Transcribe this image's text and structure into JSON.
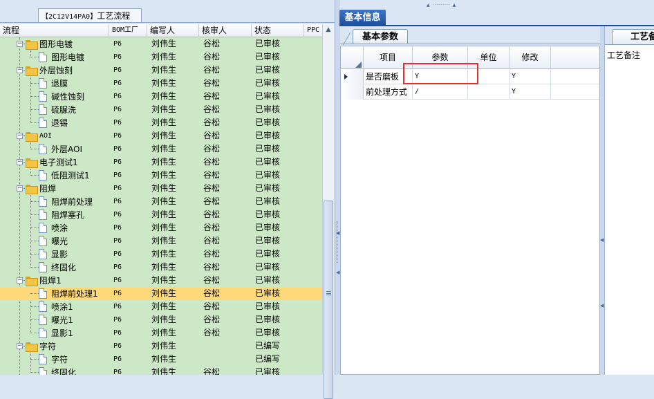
{
  "left_tab": {
    "code": "【2C12V14PA0】",
    "label": "工艺流程"
  },
  "tree_columns": [
    "流程",
    "BOM工厂",
    "编写人",
    "核审人",
    "状态",
    "PPC"
  ],
  "tree_rows": [
    {
      "level": 1,
      "type": "folder",
      "name": "图形电镀",
      "bom": "P6",
      "writer": "刘伟生",
      "reviewer": "谷松",
      "status": "已审核"
    },
    {
      "level": 2,
      "type": "doc",
      "name": "图形电镀",
      "bom": "P6",
      "writer": "刘伟生",
      "reviewer": "谷松",
      "status": "已审核"
    },
    {
      "level": 1,
      "type": "folder",
      "name": "外层蚀刻",
      "bom": "P6",
      "writer": "刘伟生",
      "reviewer": "谷松",
      "status": "已审核"
    },
    {
      "level": 2,
      "type": "doc",
      "name": "退膜",
      "bom": "P6",
      "writer": "刘伟生",
      "reviewer": "谷松",
      "status": "已审核"
    },
    {
      "level": 2,
      "type": "doc",
      "name": "碱性蚀刻",
      "bom": "P6",
      "writer": "刘伟生",
      "reviewer": "谷松",
      "status": "已审核"
    },
    {
      "level": 2,
      "type": "doc",
      "name": "硫脲洗",
      "bom": "P6",
      "writer": "刘伟生",
      "reviewer": "谷松",
      "status": "已审核"
    },
    {
      "level": 2,
      "type": "doc",
      "name": "退锡",
      "bom": "P6",
      "writer": "刘伟生",
      "reviewer": "谷松",
      "status": "已审核"
    },
    {
      "level": 1,
      "type": "folder",
      "name": "AOI",
      "bom": "P6",
      "writer": "刘伟生",
      "reviewer": "谷松",
      "status": "已审核"
    },
    {
      "level": 2,
      "type": "doc",
      "name": "外层AOI",
      "bom": "P6",
      "writer": "刘伟生",
      "reviewer": "谷松",
      "status": "已审核"
    },
    {
      "level": 1,
      "type": "folder",
      "name": "电子测试1",
      "bom": "P6",
      "writer": "刘伟生",
      "reviewer": "谷松",
      "status": "已审核"
    },
    {
      "level": 2,
      "type": "doc",
      "name": "低阻测试1",
      "bom": "P6",
      "writer": "刘伟生",
      "reviewer": "谷松",
      "status": "已审核"
    },
    {
      "level": 1,
      "type": "folder",
      "name": "阻焊",
      "bom": "P6",
      "writer": "刘伟生",
      "reviewer": "谷松",
      "status": "已审核"
    },
    {
      "level": 2,
      "type": "doc",
      "name": "阻焊前处理",
      "bom": "P6",
      "writer": "刘伟生",
      "reviewer": "谷松",
      "status": "已审核"
    },
    {
      "level": 2,
      "type": "doc",
      "name": "阻焊塞孔",
      "bom": "P6",
      "writer": "刘伟生",
      "reviewer": "谷松",
      "status": "已审核"
    },
    {
      "level": 2,
      "type": "doc",
      "name": "喷涂",
      "bom": "P6",
      "writer": "刘伟生",
      "reviewer": "谷松",
      "status": "已审核"
    },
    {
      "level": 2,
      "type": "doc",
      "name": "曝光",
      "bom": "P6",
      "writer": "刘伟生",
      "reviewer": "谷松",
      "status": "已审核"
    },
    {
      "level": 2,
      "type": "doc",
      "name": "显影",
      "bom": "P6",
      "writer": "刘伟生",
      "reviewer": "谷松",
      "status": "已审核"
    },
    {
      "level": 2,
      "type": "doc",
      "name": "终固化",
      "bom": "P6",
      "writer": "刘伟生",
      "reviewer": "谷松",
      "status": "已审核"
    },
    {
      "level": 1,
      "type": "folder",
      "name": "阻焊1",
      "bom": "P6",
      "writer": "刘伟生",
      "reviewer": "谷松",
      "status": "已审核"
    },
    {
      "level": 2,
      "type": "doc",
      "name": "阻焊前处理1",
      "bom": "P6",
      "writer": "刘伟生",
      "reviewer": "谷松",
      "status": "已审核",
      "selected": true
    },
    {
      "level": 2,
      "type": "doc",
      "name": "喷涂1",
      "bom": "P6",
      "writer": "刘伟生",
      "reviewer": "谷松",
      "status": "已审核"
    },
    {
      "level": 2,
      "type": "doc",
      "name": "曝光1",
      "bom": "P6",
      "writer": "刘伟生",
      "reviewer": "谷松",
      "status": "已审核"
    },
    {
      "level": 2,
      "type": "doc",
      "name": "显影1",
      "bom": "P6",
      "writer": "刘伟生",
      "reviewer": "谷松",
      "status": "已审核"
    },
    {
      "level": 1,
      "type": "folder",
      "name": "字符",
      "bom": "P6",
      "writer": "刘伟生",
      "reviewer": "",
      "status": "已编写"
    },
    {
      "level": 2,
      "type": "doc",
      "name": "字符",
      "bom": "P6",
      "writer": "刘伟生",
      "reviewer": "",
      "status": "已编写"
    },
    {
      "level": 2,
      "type": "doc",
      "name": "终固化",
      "bom": "P6",
      "writer": "刘伟生",
      "reviewer": "谷松",
      "status": "已审核"
    }
  ],
  "main_tab": "基本信息",
  "params_tab": "基本参数",
  "grid_columns": [
    "项目",
    "参数",
    "单位",
    "修改"
  ],
  "grid_rows": [
    {
      "item": "是否磨板",
      "param": "Y",
      "unit": "",
      "modify": "Y",
      "current": true
    },
    {
      "item": "前处理方式",
      "param": "/",
      "unit": "",
      "modify": "Y",
      "current": false
    }
  ],
  "notes_tab": "工艺备注",
  "notes_label": "工艺备注",
  "icons": {
    "folder": "folder-icon",
    "document": "document-icon",
    "collapse": "collapse-icon",
    "scroll_up": "scroll-up-arrow-icon",
    "row_pointer": "row-pointer-icon"
  },
  "colors": {
    "tree_background": "#cde8c6",
    "selected_row": "#ffd97a",
    "main_tab": "#1d4f9e",
    "highlight_box": "#e03030"
  }
}
